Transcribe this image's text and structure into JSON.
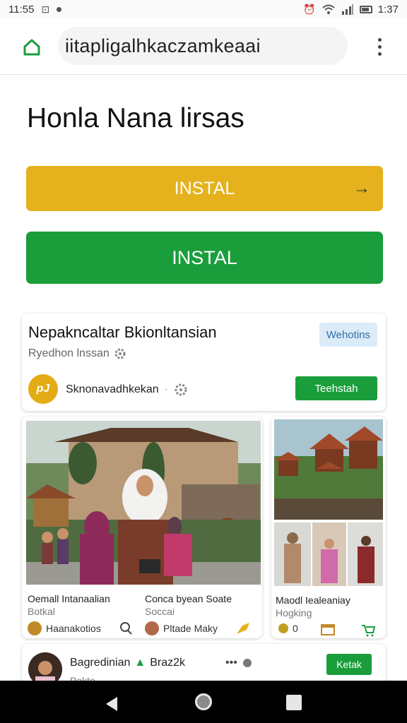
{
  "status_bar": {
    "time_left": "11:55",
    "time_right": "1:37"
  },
  "url_bar": {
    "url": "iitapligalhkaczamkeaai"
  },
  "page": {
    "title": "Honla Nana lirsas",
    "install_primary": "INSTAL",
    "install_secondary": "INSTAL"
  },
  "card_header": {
    "title": "Nepakncaltar Bkionltansian",
    "subtitle": "Ryedhon lnssan",
    "badge": "Wehotins",
    "avatar_text": "pJ",
    "author": "Sknonavadhkekan",
    "action_label": "Teehstah"
  },
  "left_tile": {
    "captions": [
      {
        "title": "Oemall Intanaalian",
        "sub": "Botkal",
        "chip": "Haanakotios"
      },
      {
        "title": "Conca byean Soate",
        "sub": "Soccai",
        "chip": "Pltade Maky"
      }
    ]
  },
  "right_tile": {
    "title": "Maodl Iealeaniay",
    "sub": "Hogking",
    "count": "0"
  },
  "bottom_card": {
    "name": "Bagredinian",
    "tag": "Braz2k",
    "sub": "Pakto",
    "action_label": "Ketak"
  },
  "colors": {
    "primary_yellow": "#e5b21d",
    "primary_green": "#1a9e3b",
    "badge_blue": "#dcebf8"
  }
}
